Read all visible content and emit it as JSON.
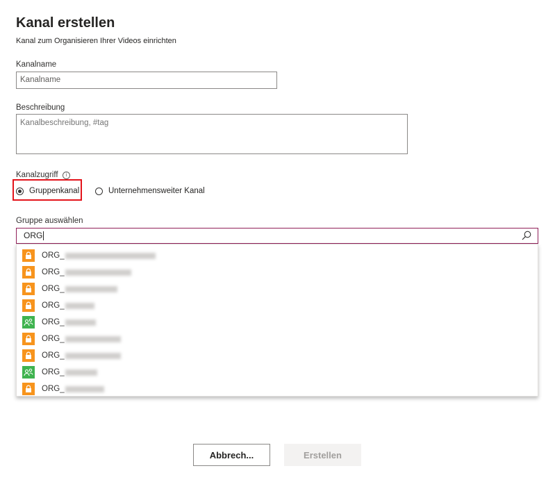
{
  "header": {
    "title": "Kanal erstellen",
    "subtitle": "Kanal zum Organisieren Ihrer Videos einrichten"
  },
  "form": {
    "name_label": "Kanalname",
    "name_placeholder": "Kanalname",
    "description_label": "Beschreibung",
    "description_placeholder": "Kanalbeschreibung, #tag",
    "access_label": "Kanalzugriff",
    "access_info_icon": "info-icon",
    "access_options": [
      {
        "label": "Gruppenkanal",
        "selected": true
      },
      {
        "label": "Unternehmensweiter Kanal",
        "selected": false
      }
    ],
    "group_label": "Gruppe auswählen",
    "group_search_value": "ORG",
    "group_search_icon": "search-icon"
  },
  "dropdown": {
    "options": [
      {
        "prefix": "ORG_",
        "icon": "lock-icon",
        "color": "#f7941d",
        "redacted": true
      },
      {
        "prefix": "ORG_",
        "icon": "lock-icon",
        "color": "#f7941d",
        "redacted": true
      },
      {
        "prefix": "ORG_",
        "icon": "lock-icon",
        "color": "#f7941d",
        "redacted": true
      },
      {
        "prefix": "ORG_",
        "icon": "lock-icon",
        "color": "#f7941d",
        "redacted": true
      },
      {
        "prefix": "ORG_",
        "icon": "people-icon",
        "color": "#3fb34f",
        "redacted": true
      },
      {
        "prefix": "ORG_",
        "icon": "lock-icon",
        "color": "#f7941d",
        "redacted": true
      },
      {
        "prefix": "ORG_",
        "icon": "lock-icon",
        "color": "#f7941d",
        "redacted": true
      },
      {
        "prefix": "ORG_",
        "icon": "people-icon",
        "color": "#3fb34f",
        "redacted": true
      },
      {
        "prefix": "ORG_",
        "icon": "lock-icon",
        "color": "#f7941d",
        "redacted": true
      }
    ]
  },
  "footer": {
    "cancel_label": "Abbrech...",
    "create_label": "Erstellen"
  },
  "colors": {
    "highlight": "#e3131a",
    "focus_border": "#8f1f58",
    "lock_badge": "#f7941d",
    "people_badge": "#3fb34f"
  }
}
